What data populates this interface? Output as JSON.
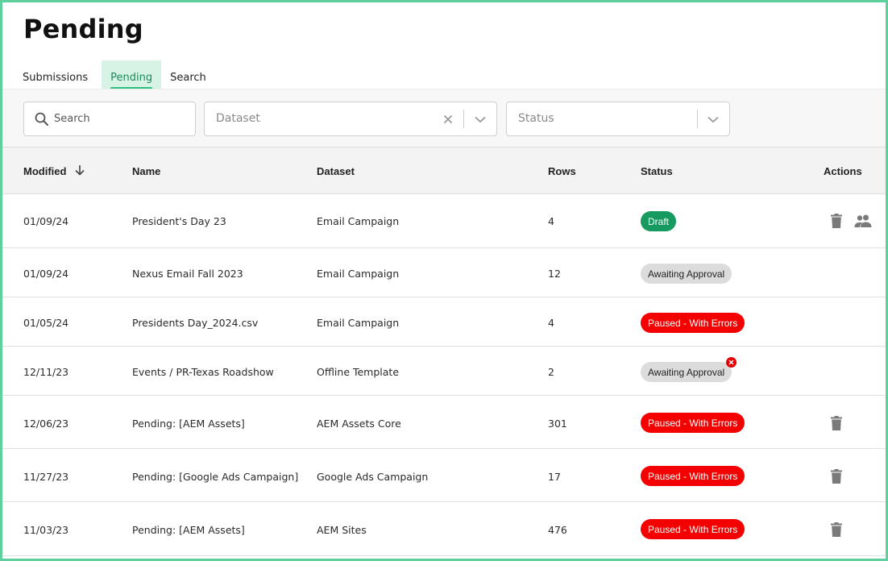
{
  "page": {
    "title": "Pending"
  },
  "tabs": [
    {
      "label": "Submissions",
      "active": false
    },
    {
      "label": "Pending",
      "active": true
    },
    {
      "label": "Search",
      "active": false
    }
  ],
  "filters": {
    "search": {
      "placeholder": "Search",
      "icon": "search-icon"
    },
    "dataset": {
      "placeholder": "Dataset",
      "clear_icon": "close-icon",
      "dropdown_icon": "chevron-down-icon"
    },
    "status": {
      "placeholder": "Status",
      "dropdown_icon": "chevron-down-icon"
    }
  },
  "table": {
    "columns": {
      "modified": "Modified",
      "name": "Name",
      "dataset": "Dataset",
      "rows": "Rows",
      "status": "Status",
      "actions": "Actions"
    },
    "sort_icon": "arrow-down-icon",
    "rows": [
      {
        "modified": "01/09/24",
        "name": "President's Day 23",
        "dataset": "Email Campaign",
        "rows": "4",
        "status": "Draft",
        "status_kind": "draft",
        "has_error": false,
        "actions": [
          "delete-icon",
          "people-icon"
        ]
      },
      {
        "modified": "01/09/24",
        "name": "Nexus Email Fall 2023",
        "dataset": "Email Campaign",
        "rows": "12",
        "status": "Awaiting Approval",
        "status_kind": "awaiting",
        "has_error": false,
        "actions": []
      },
      {
        "modified": "01/05/24",
        "name": "Presidents Day_2024.csv",
        "dataset": "Email Campaign",
        "rows": "4",
        "status": "Paused - With Errors",
        "status_kind": "paused",
        "has_error": false,
        "actions": []
      },
      {
        "modified": "12/11/23",
        "name": "Events / PR-Texas Roadshow",
        "dataset": "Offline Template",
        "rows": "2",
        "status": "Awaiting Approval",
        "status_kind": "awaiting",
        "has_error": true,
        "actions": []
      },
      {
        "modified": "12/06/23",
        "name": "Pending: [AEM Assets]",
        "dataset": "AEM Assets Core",
        "rows": "301",
        "status": "Paused - With Errors",
        "status_kind": "paused",
        "has_error": false,
        "actions": [
          "delete-icon"
        ]
      },
      {
        "modified": "11/27/23",
        "name": "Pending: [Google Ads Campaign]",
        "dataset": "Google Ads Campaign",
        "rows": "17",
        "status": "Paused - With Errors",
        "status_kind": "paused",
        "has_error": false,
        "actions": [
          "delete-icon"
        ]
      },
      {
        "modified": "11/03/23",
        "name": "Pending: [AEM Assets]",
        "dataset": "AEM Sites",
        "rows": "476",
        "status": "Paused - With Errors",
        "status_kind": "paused",
        "has_error": false,
        "actions": [
          "delete-icon"
        ]
      }
    ]
  },
  "colors": {
    "frame_border": "#5fcf9b",
    "tab_active_bg": "#d7f3e5",
    "tab_active_text": "#1f8a5b",
    "tab_underline": "#2fc07d",
    "draft": "#169a5f",
    "awaiting": "#dcdcdc",
    "paused": "#f40000",
    "icon_gray": "#7a7a7a"
  }
}
